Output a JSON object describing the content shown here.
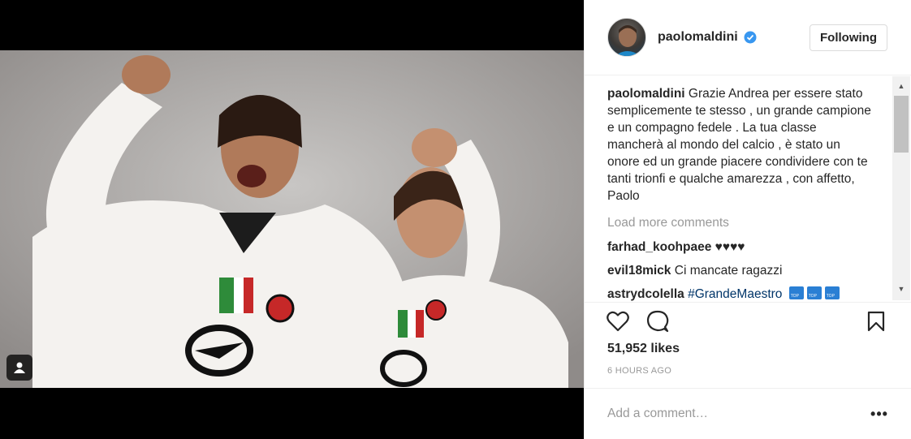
{
  "post": {
    "username": "paolomaldini",
    "follow_label": "Following",
    "caption_username": "paolomaldini",
    "caption_text": "Grazie Andrea per essere stato semplicemente te stesso , un grande campione e un compagno fedele . La tua classe mancherà al mondo del calcio , è stato un onore ed un grande piacere condividere con te tanti trionfi e qualche amarezza , con affetto, Paolo",
    "load_more": "Load more comments",
    "comments": [
      {
        "user": "farhad_koohpaee",
        "text": "♥♥♥♥"
      },
      {
        "user": "evil18mick",
        "text": "Ci mancate ragazzi"
      },
      {
        "user": "astrydcolella",
        "text": "#GrandeMaestro"
      }
    ],
    "likes": "51,952 likes",
    "time": "6 HOURS AGO",
    "add_comment_placeholder": "Add a comment…",
    "more_label": "•••"
  },
  "icons": {
    "tag": "user-tag-icon",
    "verified": "verified-badge-icon",
    "heart": "heart-icon",
    "comment": "comment-bubble-icon",
    "bookmark": "bookmark-icon",
    "more": "more-options-icon"
  },
  "colors": {
    "verified": "#3897f0",
    "hashtag": "#003569",
    "muted": "#999999",
    "text": "#262626"
  }
}
